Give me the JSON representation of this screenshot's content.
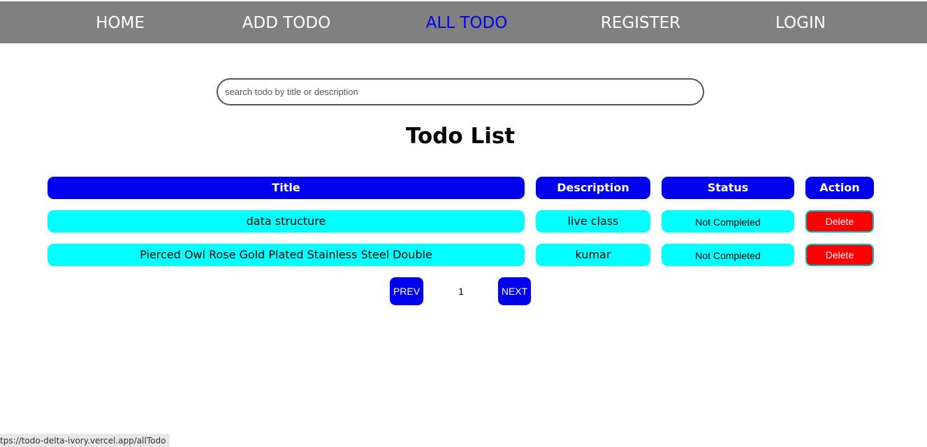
{
  "nav": {
    "items": [
      {
        "label": "HOME"
      },
      {
        "label": "ADD TODO"
      },
      {
        "label": "ALL TODO"
      },
      {
        "label": "REGISTER"
      },
      {
        "label": "LOGIN"
      }
    ],
    "active": "ALL TODO",
    "active_color": "#0000ee",
    "background_color": "#808080"
  },
  "search": {
    "placeholder": "search todo by title or description",
    "value": ""
  },
  "heading": "Todo List",
  "table": {
    "headers": {
      "title": "Title",
      "description": "Description",
      "status": "Status",
      "action": "Action"
    },
    "rows": [
      {
        "title": "data structure",
        "description": "live class",
        "status": "Not Completed",
        "action": "Delete"
      },
      {
        "title": "Pierced Owl Rose Gold Plated Stainless Steel Double",
        "description": "kumar",
        "status": "Not Completed",
        "action": "Delete"
      }
    ],
    "header_color": "#0000ee",
    "row_color": "#00ffff",
    "delete_color": "#ff0000"
  },
  "pagination": {
    "prev_label": "PREV",
    "page": "1",
    "next_label": "NEXT"
  },
  "status_bar": {
    "url": "tps://todo-delta-ivory.vercel.app/allTodo"
  }
}
